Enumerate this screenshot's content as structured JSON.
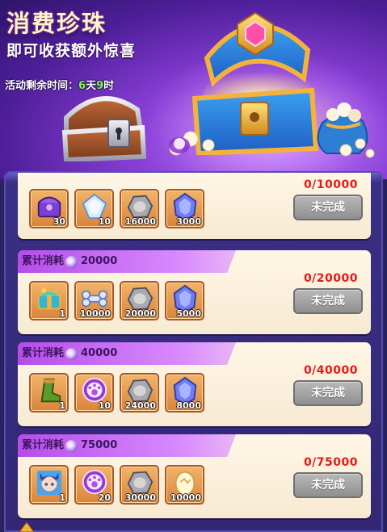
{
  "banner": {
    "title": "消费珍珠",
    "subtitle": "即可收获额外惊喜",
    "timer_prefix": "活动剩余时间：",
    "timer_days": "6",
    "timer_days_unit": "天",
    "timer_hours": "9",
    "timer_hours_unit": "时"
  },
  "tasks": [
    {
      "label": "",
      "amount": "",
      "progress": "0/10000",
      "button": "未完成",
      "rewards": [
        {
          "icon": "purple-chest-icon",
          "qty": "30"
        },
        {
          "icon": "diamond-shard-icon",
          "qty": "10"
        },
        {
          "icon": "stone-ore-icon",
          "qty": "16000"
        },
        {
          "icon": "blue-crystal-icon",
          "qty": "3000"
        }
      ]
    },
    {
      "label": "累计消耗",
      "amount": "20000",
      "progress": "0/20000",
      "button": "未完成",
      "rewards": [
        {
          "icon": "gift-chest-icon",
          "qty": "1"
        },
        {
          "icon": "bone-icon",
          "qty": "10000"
        },
        {
          "icon": "stone-ore-icon",
          "qty": "20000"
        },
        {
          "icon": "blue-crystal-icon",
          "qty": "5000"
        }
      ]
    },
    {
      "label": "累计消耗",
      "amount": "40000",
      "progress": "0/40000",
      "button": "未完成",
      "rewards": [
        {
          "icon": "green-boot-icon",
          "qty": "1"
        },
        {
          "icon": "paw-badge-icon",
          "qty": "10"
        },
        {
          "icon": "stone-ore-icon",
          "qty": "24000"
        },
        {
          "icon": "blue-crystal-icon",
          "qty": "8000"
        }
      ]
    },
    {
      "label": "累计消耗",
      "amount": "75000",
      "progress": "0/75000",
      "button": "未完成",
      "rewards": [
        {
          "icon": "hero-portrait-icon",
          "qty": "1"
        },
        {
          "icon": "paw-badge-icon",
          "qty": "20"
        },
        {
          "icon": "stone-ore-icon",
          "qty": "30000"
        },
        {
          "icon": "egg-icon",
          "qty": "10000"
        }
      ]
    }
  ],
  "colors": {
    "progress_red": "#e31b1b",
    "timer_green": "#7dff3c",
    "label_purple": "#b44de8"
  }
}
